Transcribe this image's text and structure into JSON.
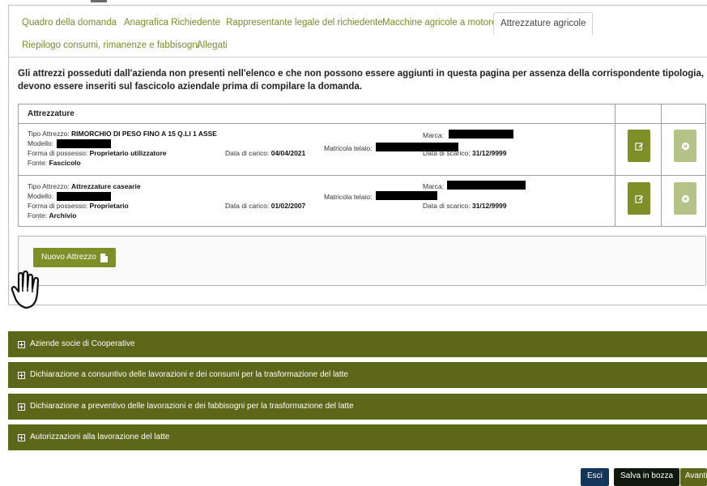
{
  "tabs": {
    "row1": [
      {
        "label": "Quadro della domanda",
        "active": false
      },
      {
        "label": "Anagrafica Richiedente",
        "active": false
      },
      {
        "label": "Rappresentante legale del richiedente",
        "active": false
      },
      {
        "label": "Macchine agricole a motore",
        "active": false
      },
      {
        "label": "Attrezzature agricole",
        "active": true
      }
    ],
    "row2": [
      {
        "label": "Riepilogo consumi, rimanenze e fabbisogni",
        "active": false
      },
      {
        "label": "Allegati",
        "active": false
      }
    ]
  },
  "notice": "Gli attrezzi posseduti dall'azienda non presenti nell'elenco e che non possono essere aggiunti in questa pagina per assenza della corrispondente tipologia, devono essere inseriti sul fascicolo aziendale prima di compilare la domanda.",
  "table": {
    "header": "Attrezzature",
    "rows": [
      {
        "tipo_label": "Tipo Attrezzo:",
        "tipo": "RIMORCHIO DI PESO FINO A 15 Q.LI 1 ASSE",
        "modello_label": "Modello:",
        "forma_label": "Forma di possesso:",
        "forma": "Proprietario utilizzatore",
        "fonte_label": "Fonte:",
        "fonte": "Fascicolo",
        "carico_label": "Data di carico:",
        "carico": "04/04/2021",
        "matricola_label": "Matricola telaio:",
        "marca_label": "Marca:",
        "scarico_label": "Data di scarico:",
        "scarico": "31/12/9999"
      },
      {
        "tipo_label": "Tipo Attrezzo:",
        "tipo": "Attrezzature casearie",
        "modello_label": "Modello:",
        "forma_label": "Forma di possesso:",
        "forma": "Proprietario",
        "fonte_label": "Fonte:",
        "fonte": "Archivio",
        "carico_label": "Data di carico:",
        "carico": "01/02/2007",
        "matricola_label": "Matricola telaio:",
        "marca_label": "Marca:",
        "scarico_label": "Data di scarico:",
        "scarico": "31/12/9999"
      }
    ]
  },
  "new_button": "Nuovo Attrezzo",
  "accordions": [
    "Aziende socie di Cooperative",
    "Dichiarazione a consuntivo delle lavorazioni e dei consumi per la trasformazione del latte",
    "Dichiarazione a preventivo delle lavorazioni e dei fabbisogni per la trasformazione del latte",
    "Autorizzazioni alla lavorazione del latte"
  ],
  "footer": {
    "esci": "Esci",
    "bozza": "Salva in bozza",
    "avanti": "Avanti"
  },
  "colors": {
    "accent": "#7d8f26",
    "accordion": "#5c6719",
    "esci": "#14365a",
    "bozza": "#0f1a0d"
  },
  "icons": {
    "edit": "edit-icon",
    "delete": "delete-icon",
    "new": "file-icon",
    "expand": "plus-square-icon",
    "cursor": "hand-pointer-icon"
  }
}
